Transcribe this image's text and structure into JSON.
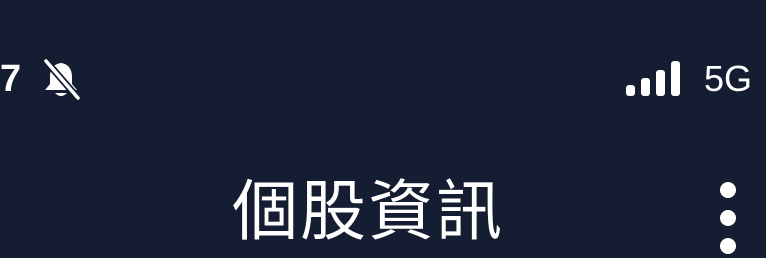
{
  "status_bar": {
    "time": "7",
    "mute_icon": "bell-slash-icon",
    "signal_icon": "cellular-signal-icon",
    "signal_bars": 4,
    "network": "5G"
  },
  "header": {
    "title": "個股資訊",
    "menu_icon": "more-vertical-icon"
  },
  "colors": {
    "background": "#141d31",
    "foreground": "#ffffff"
  }
}
